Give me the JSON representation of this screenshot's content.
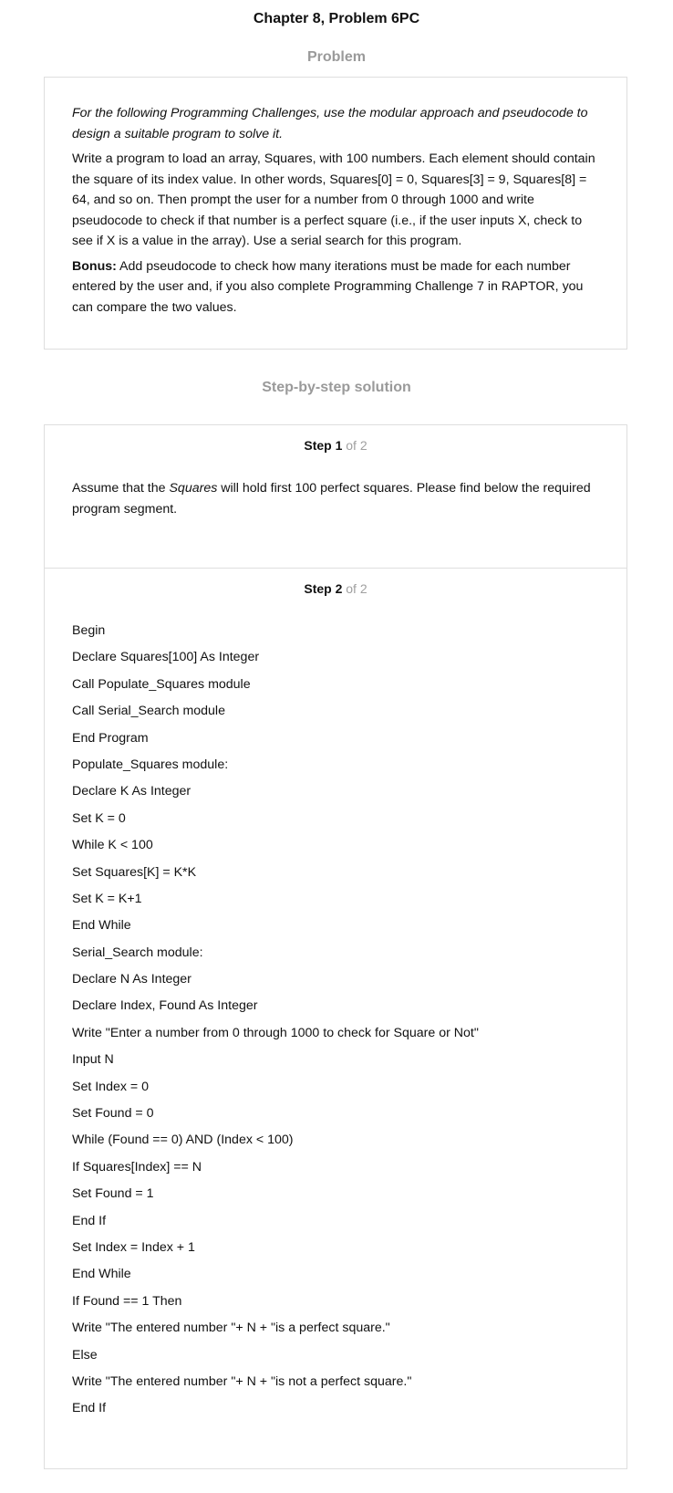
{
  "title": "Chapter 8, Problem 6PC",
  "problem": {
    "heading": "Problem",
    "intro": "For the following Programming Challenges, use the modular approach and pseudocode to design a suitable program to solve it.",
    "body": "Write a program to load an array, Squares, with 100 numbers. Each element should contain the square of its index value. In other words, Squares[0] = 0, Squares[3] = 9, Squares[8] = 64, and so on. Then prompt the user for a number from 0 through 1000 and write pseudocode to check if that number is a perfect square (i.e., if the user inputs X, check to see if X is a value in the array). Use a serial search for this program.",
    "bonus_label": "Bonus:",
    "bonus_text": " Add pseudocode to check how many iterations must be made for each number entered by the user and, if you also complete Programming Challenge 7 in RAPTOR, you can compare the two values."
  },
  "solution": {
    "heading": "Step-by-step solution",
    "steps": [
      {
        "label": "Step 1",
        "of": " of 2",
        "text_before": "Assume that the ",
        "text_emphasis": "Squares",
        "text_after": " will hold first 100 perfect squares. Please find below the required program segment."
      },
      {
        "label": "Step 2",
        "of": " of 2",
        "lines": [
          "Begin",
          "Declare Squares[100] As Integer",
          "Call Populate_Squares module",
          "Call Serial_Search module",
          "End Program",
          "Populate_Squares module:",
          "Declare K As Integer",
          "Set K = 0",
          "While K < 100",
          "Set Squares[K] = K*K",
          "Set K = K+1",
          "End While",
          "Serial_Search module:",
          "Declare N As Integer",
          "Declare Index, Found As Integer",
          "Write \"Enter a number from 0 through 1000 to check for Square or Not\"",
          "Input N",
          "Set Index = 0",
          "Set Found = 0",
          "While (Found == 0) AND (Index < 100)",
          "If Squares[Index] == N",
          "Set Found = 1",
          "End If",
          "Set Index = Index + 1",
          "End While",
          "If Found == 1 Then",
          "Write \"The entered number \"+ N + \"is a perfect square.\"",
          "Else",
          "Write \"The entered number \"+ N + \"is not a perfect square.\"",
          "End If"
        ]
      }
    ]
  }
}
